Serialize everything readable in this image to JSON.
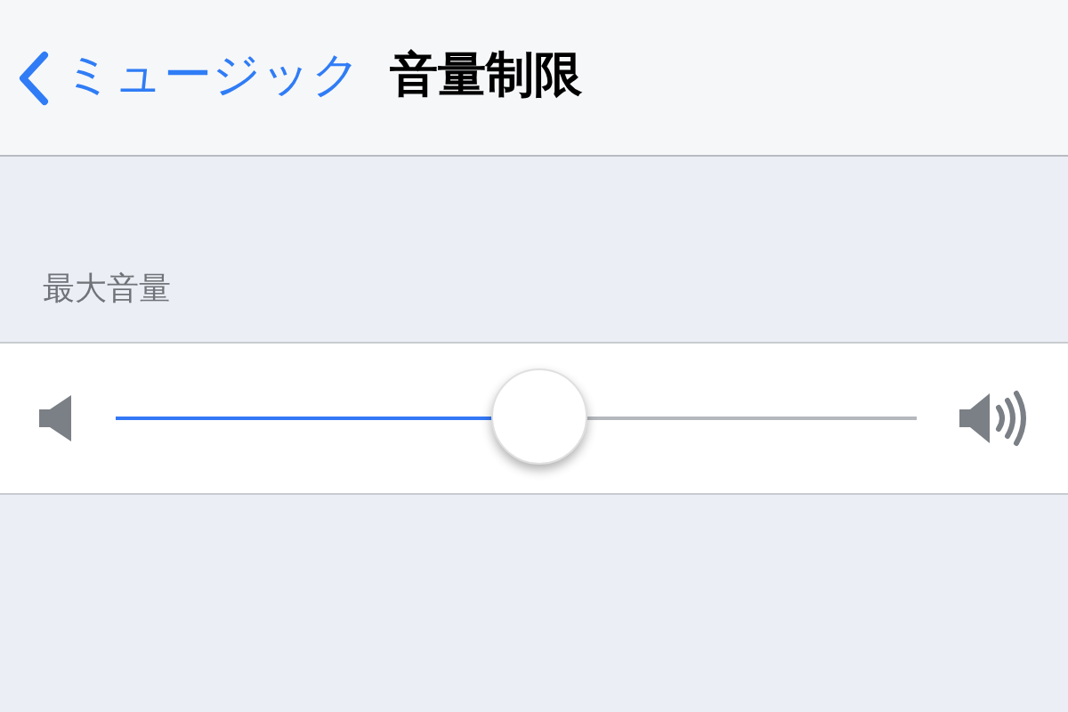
{
  "nav_bar": {
    "back_label": "ミュージック",
    "title": "音量制限"
  },
  "section": {
    "header": "最大音量"
  },
  "volume_slider": {
    "level": 0.53
  }
}
